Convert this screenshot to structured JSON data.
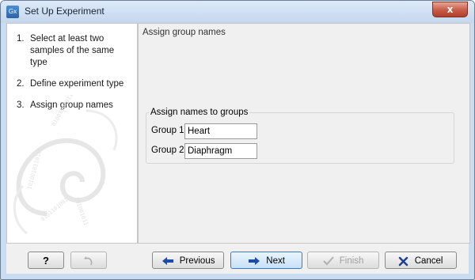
{
  "window": {
    "title": "Set Up Experiment",
    "app_icon": "Gx",
    "close_glyph": "x"
  },
  "steps": [
    {
      "num": "1.",
      "label": "Select at least two samples of the same type"
    },
    {
      "num": "2.",
      "label": "Define experiment type"
    },
    {
      "num": "3.",
      "label": "Assign group names"
    }
  ],
  "content": {
    "title": "Assign group names",
    "groupbox_title": "Assign names to groups",
    "groups": [
      {
        "label": "Group 1",
        "value": "Heart"
      },
      {
        "label": "Group 2",
        "value": "Diaphragm"
      }
    ]
  },
  "buttons": {
    "help": "?",
    "previous": "Previous",
    "next": "Next",
    "finish": "Finish",
    "cancel": "Cancel"
  },
  "colors": {
    "accent": "#2a64a8",
    "close": "#c75a46",
    "cancel_x": "#1d3f8f"
  }
}
